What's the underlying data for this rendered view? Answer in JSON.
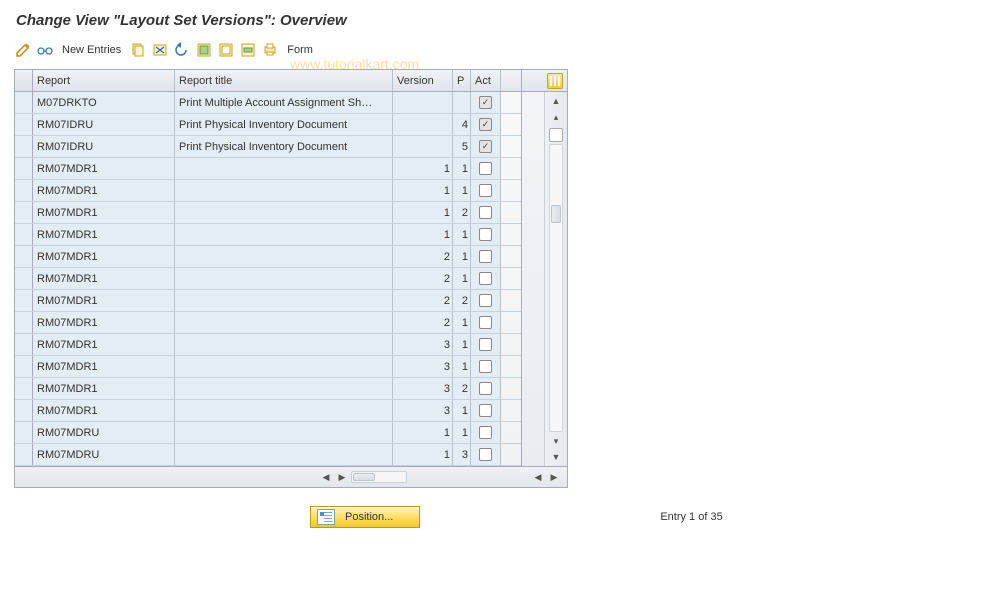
{
  "title": "Change View \"Layout Set Versions\": Overview",
  "watermark": "www.tutorialkart.com",
  "toolbar": {
    "new_entries": "New Entries",
    "form": "Form"
  },
  "columns": {
    "report": "Report",
    "title": "Report title",
    "version": "Version",
    "p": "P",
    "act": "Act"
  },
  "rows": [
    {
      "report": "M07DRKTO",
      "title": "Print Multiple Account Assignment Sh…",
      "version": "",
      "p": "",
      "act": true
    },
    {
      "report": "RM07IDRU",
      "title": "Print Physical Inventory Document",
      "version": "",
      "p": "4",
      "act": true
    },
    {
      "report": "RM07IDRU",
      "title": "Print Physical Inventory Document",
      "version": "",
      "p": "5",
      "act": true
    },
    {
      "report": "RM07MDR1",
      "title": "",
      "version": "1",
      "p": "1",
      "act": false
    },
    {
      "report": "RM07MDR1",
      "title": "",
      "version": "1",
      "p": "1",
      "act": false
    },
    {
      "report": "RM07MDR1",
      "title": "",
      "version": "1",
      "p": "2",
      "act": false
    },
    {
      "report": "RM07MDR1",
      "title": "",
      "version": "1",
      "p": "1",
      "act": false
    },
    {
      "report": "RM07MDR1",
      "title": "",
      "version": "2",
      "p": "1",
      "act": false
    },
    {
      "report": "RM07MDR1",
      "title": "",
      "version": "2",
      "p": "1",
      "act": false
    },
    {
      "report": "RM07MDR1",
      "title": "",
      "version": "2",
      "p": "2",
      "act": false
    },
    {
      "report": "RM07MDR1",
      "title": "",
      "version": "2",
      "p": "1",
      "act": false
    },
    {
      "report": "RM07MDR1",
      "title": "",
      "version": "3",
      "p": "1",
      "act": false
    },
    {
      "report": "RM07MDR1",
      "title": "",
      "version": "3",
      "p": "1",
      "act": false
    },
    {
      "report": "RM07MDR1",
      "title": "",
      "version": "3",
      "p": "2",
      "act": false
    },
    {
      "report": "RM07MDR1",
      "title": "",
      "version": "3",
      "p": "1",
      "act": false
    },
    {
      "report": "RM07MDRU",
      "title": "",
      "version": "1",
      "p": "1",
      "act": false
    },
    {
      "report": "RM07MDRU",
      "title": "",
      "version": "1",
      "p": "3",
      "act": false
    }
  ],
  "position_button": "Position...",
  "entry_info": "Entry 1 of 35"
}
